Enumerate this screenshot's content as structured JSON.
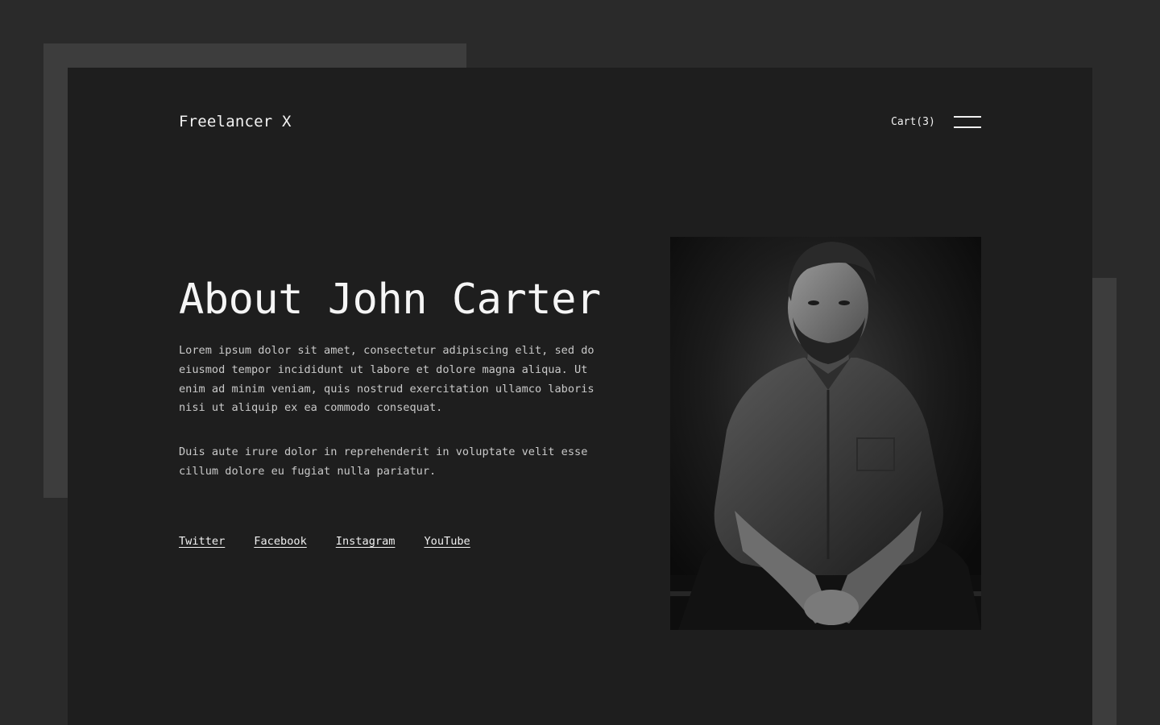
{
  "header": {
    "brand": "Freelancer X",
    "cart_label": "Cart(3)"
  },
  "hero": {
    "title": "About John Carter",
    "paragraphs": [
      "Lorem ipsum dolor sit amet, consectetur adipiscing elit, sed do eiusmod tempor incididunt ut labore et dolore magna aliqua. Ut enim ad minim veniam, quis nostrud exercitation ullamco laboris nisi ut aliquip ex ea commodo consequat.",
      "Duis aute irure dolor in reprehenderit in voluptate velit esse cillum dolore eu fugiat nulla pariatur."
    ]
  },
  "social": {
    "links": [
      "Twitter",
      "Facebook",
      "Instagram",
      "YouTube"
    ]
  },
  "colors": {
    "page_background": "#2a2a2a",
    "card_background": "#1e1e1e",
    "decor_panel": "#3d3d3d",
    "text_primary": "#f5f5f5",
    "text_body": "#c9c9c9"
  },
  "icons": {
    "menu": "hamburger-menu-icon"
  }
}
